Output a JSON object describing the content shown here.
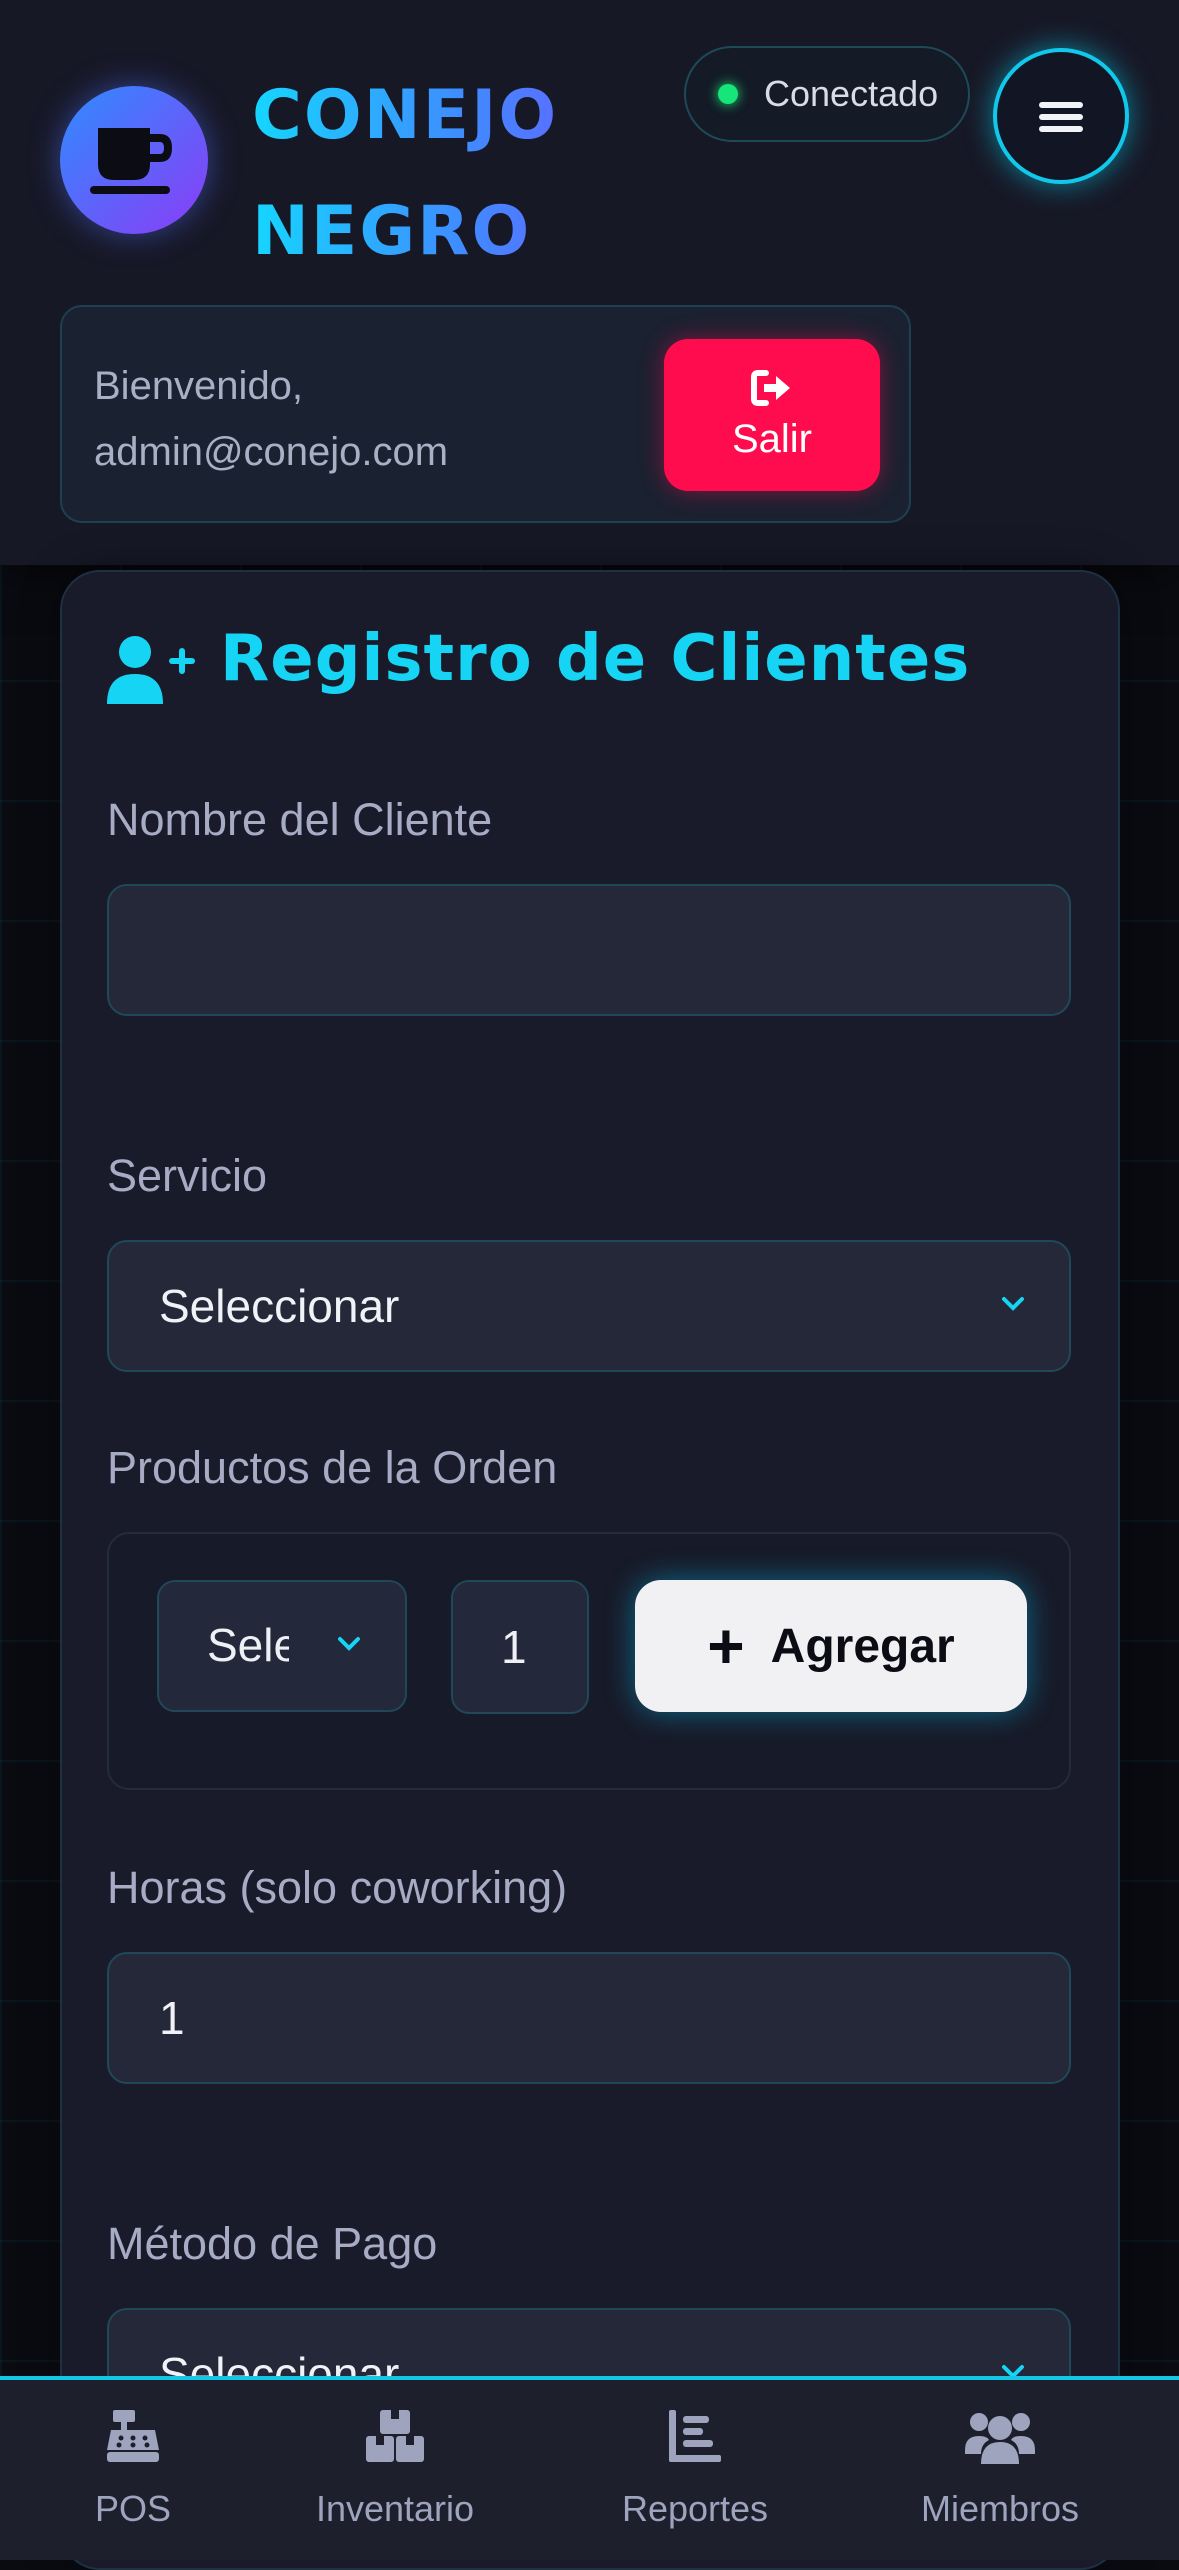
{
  "header": {
    "logo_icon": "coffee-cup-icon",
    "brand_line1": "CONEJO",
    "brand_line2": "NEGRO",
    "status": {
      "label": "Conectado",
      "color": "#16e67a"
    },
    "menu_icon": "hamburger-menu-icon"
  },
  "welcome": {
    "greeting": "Bienvenido,",
    "user": "admin@conejo.com",
    "logout_label": "Salir",
    "logout_icon": "sign-out-icon"
  },
  "form": {
    "title": "Registro de Clientes",
    "title_icon": "user-plus-icon",
    "client_name_label": "Nombre del Cliente",
    "client_name_value": "",
    "service_label": "Servicio",
    "service_value": "Seleccionar",
    "products_label": "Productos de la Orden",
    "product_select_value": "Sele",
    "quantity_value": "1",
    "add_button_label": "Agregar",
    "hours_label": "Horas (solo coworking)",
    "hours_value": "1",
    "payment_label": "Método de Pago",
    "payment_value": "Seleccionar"
  },
  "nav": {
    "items": [
      {
        "label": "POS",
        "icon": "cash-register-icon"
      },
      {
        "label": "Inventario",
        "icon": "boxes-icon"
      },
      {
        "label": "Reportes",
        "icon": "bar-chart-icon"
      },
      {
        "label": "Miembros",
        "icon": "users-icon"
      }
    ]
  },
  "colors": {
    "accent_cyan": "#16d4f3",
    "logout_red": "#ff0c4f",
    "background": "#0a0b11",
    "card": "#191b2b"
  }
}
